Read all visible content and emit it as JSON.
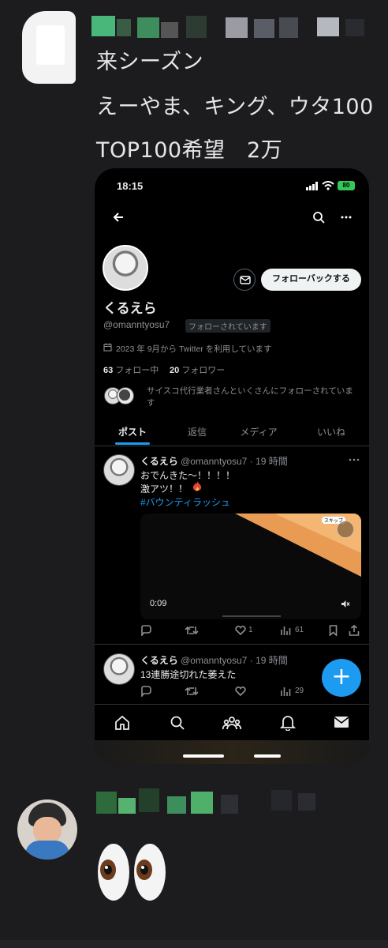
{
  "comment1": {
    "lines": [
      "来シーズン",
      "えーやま、キング、ウタ100",
      "TOP100希望　2万"
    ]
  },
  "phone": {
    "status": {
      "time": "18:15",
      "battery": "80"
    },
    "profile": {
      "display_name": "くるえら",
      "handle": "@omanntyosu7",
      "follows_you": "フォローされています",
      "follow_back_label": "フォローバックする",
      "joined": "2023 年 9月から Twitter を利用しています",
      "following_count": "63",
      "following_label": "フォロー中",
      "followers_count": "20",
      "followers_label": "フォロワー",
      "followed_by": "サイスコ代行業者さんといくさんにフォローされています"
    },
    "tabs": [
      "ポスト",
      "返信",
      "メディア",
      "いいね"
    ],
    "posts": [
      {
        "name": "くるえら",
        "handle": "@omanntyosu7",
        "time": "· 19 時間",
        "lines": [
          "おでんきた〜！！！！",
          "激アツ！！"
        ],
        "hashtag": "#バウンティラッシュ",
        "video_time": "0:09",
        "skip_label": "スキップ",
        "likes": "1",
        "views": "61"
      },
      {
        "name": "くるえら",
        "handle": "@omanntyosu7",
        "time": "· 19 時間",
        "lines": [
          "13連勝途切れた萎えた"
        ],
        "views": "29"
      }
    ],
    "fab_label": "+"
  },
  "comment2": {
    "emoji": "👀"
  },
  "colors": {
    "background": "#1c1c1f",
    "accent": "#1d9bf0",
    "phone_bg": "#000000"
  },
  "icons": {
    "back": "back-arrow-icon",
    "search": "search-icon",
    "more": "more-icon",
    "message": "message-icon",
    "calendar": "calendar-icon",
    "reply": "reply-icon",
    "repost": "repost-icon",
    "like": "heart-icon",
    "views": "views-icon",
    "bookmark": "bookmark-icon",
    "share": "share-icon",
    "fire": "fire-icon",
    "home": "home-icon",
    "communities": "communities-icon",
    "notifications": "bell-icon",
    "messages": "envelope-icon",
    "mute": "mute-icon"
  }
}
